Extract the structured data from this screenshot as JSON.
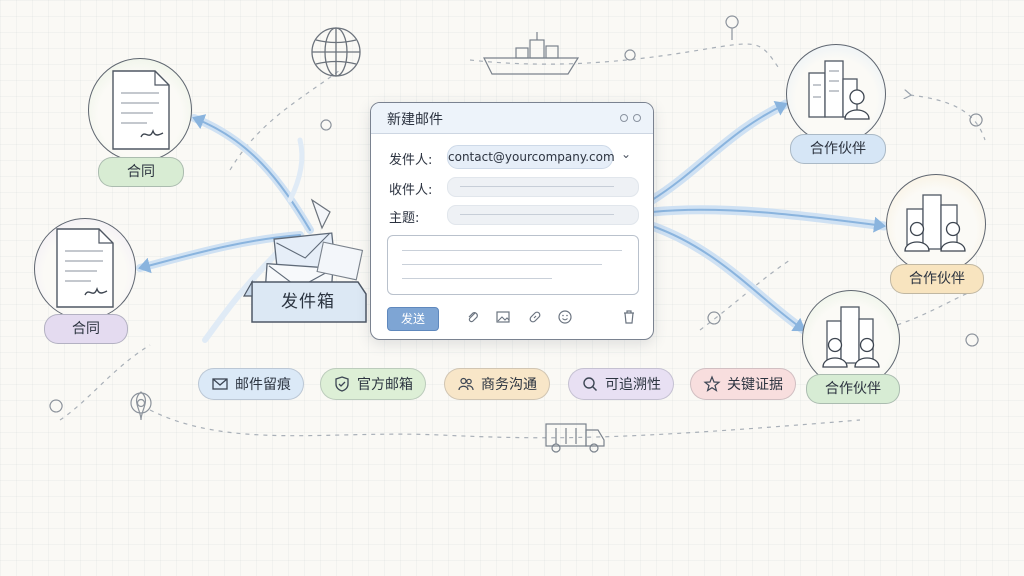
{
  "contracts": [
    {
      "label": "合同",
      "color": "#d8ecd3"
    },
    {
      "label": "合同",
      "color": "#e4dbf0"
    }
  ],
  "outbox": {
    "label": "发件箱"
  },
  "compose": {
    "title": "新建邮件",
    "from_label": "发件人:",
    "from_value": "contact@yourcompany.com",
    "to_label": "收件人:",
    "subject_label": "主题:",
    "send_label": "发送"
  },
  "partners": [
    {
      "label": "合作伙伴",
      "color": "#d6e6f6"
    },
    {
      "label": "合作伙伴",
      "color": "#f8e4bf"
    },
    {
      "label": "合作伙伴",
      "color": "#d7ecd4"
    }
  ],
  "features": [
    {
      "label": "邮件留痕",
      "icon": "mail-icon",
      "color": "#dbe9f7"
    },
    {
      "label": "官方邮箱",
      "icon": "shield-icon",
      "color": "#ddefd6"
    },
    {
      "label": "商务沟通",
      "icon": "people-icon",
      "color": "#f8e6c8"
    },
    {
      "label": "可追溯性",
      "icon": "search-icon",
      "color": "#e8e0f3"
    },
    {
      "label": "关键证据",
      "icon": "star-icon",
      "color": "#f8dede"
    }
  ],
  "decor_icons": [
    "globe-icon",
    "ship-icon",
    "truck-icon",
    "location-pin-icon"
  ]
}
